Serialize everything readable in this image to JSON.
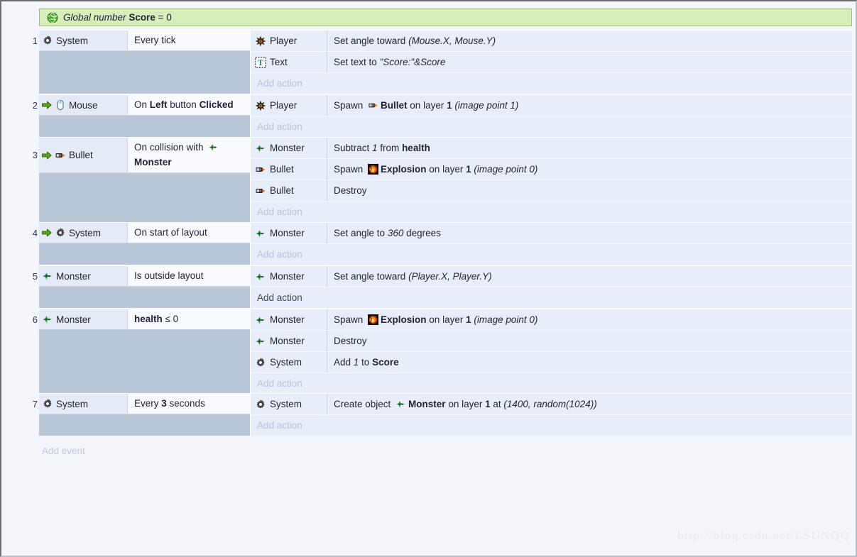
{
  "window": {
    "watermark": "http://blog.csdn.net/LSUNQQ"
  },
  "global_variable": {
    "icon": "globe-icon",
    "prefix": "Global number",
    "name": "Score",
    "equals": "=",
    "value": "0"
  },
  "add_event_label": "Add event",
  "add_action_label": "Add action",
  "events": [
    {
      "number": "1",
      "conditions": [
        {
          "arrow": false,
          "icon": "system-gear-icon",
          "object": "System",
          "text_parts": [
            {
              "t": "Every tick"
            }
          ]
        }
      ],
      "actions": [
        {
          "icon": "player-icon",
          "object": "Player",
          "text_parts": [
            {
              "t": "Set angle toward "
            },
            {
              "t": "(Mouse.X, Mouse.Y)",
              "style": "i"
            }
          ]
        },
        {
          "icon": "text-object-icon",
          "object": "Text",
          "text_parts": [
            {
              "t": "Set text to "
            },
            {
              "t": "\"Score:\"&Score",
              "style": "i"
            }
          ]
        }
      ],
      "add_action_hover": false
    },
    {
      "number": "2",
      "conditions": [
        {
          "arrow": true,
          "icon": "mouse-icon",
          "object": "Mouse",
          "text_parts": [
            {
              "t": "On "
            },
            {
              "t": "Left",
              "style": "b"
            },
            {
              "t": " button "
            },
            {
              "t": "Clicked",
              "style": "b"
            }
          ]
        }
      ],
      "actions": [
        {
          "icon": "player-icon",
          "object": "Player",
          "text_parts": [
            {
              "t": "Spawn "
            },
            {
              "inline_icon": "bullet-icon"
            },
            {
              "t": "Bullet",
              "style": "b"
            },
            {
              "t": " on layer "
            },
            {
              "t": "1",
              "style": "b"
            },
            {
              "t": " (image point 1)",
              "style": "i"
            }
          ]
        }
      ],
      "add_action_hover": false
    },
    {
      "number": "3",
      "conditions": [
        {
          "arrow": true,
          "icon": "bullet-icon",
          "object": "Bullet",
          "text_parts": [
            {
              "t": "On collision with "
            },
            {
              "inline_icon": "monster-icon"
            },
            {
              "t": "Monster",
              "style": "b",
              "newline": true
            }
          ]
        }
      ],
      "actions": [
        {
          "icon": "monster-icon",
          "object": "Monster",
          "text_parts": [
            {
              "t": "Subtract "
            },
            {
              "t": "1",
              "style": "i"
            },
            {
              "t": " from "
            },
            {
              "t": "health",
              "style": "b"
            }
          ]
        },
        {
          "icon": "bullet-icon",
          "object": "Bullet",
          "text_parts": [
            {
              "t": "Spawn "
            },
            {
              "inline_icon": "explosion-icon"
            },
            {
              "t": "Explosion",
              "style": "b"
            },
            {
              "t": " on layer "
            },
            {
              "t": "1",
              "style": "b"
            },
            {
              "t": " (image point 0)",
              "style": "i"
            }
          ]
        },
        {
          "icon": "bullet-icon",
          "object": "Bullet",
          "text_parts": [
            {
              "t": "Destroy"
            }
          ]
        }
      ],
      "add_action_hover": false
    },
    {
      "number": "4",
      "conditions": [
        {
          "arrow": true,
          "icon": "system-gear-icon",
          "object": "System",
          "text_parts": [
            {
              "t": "On start of layout"
            }
          ]
        }
      ],
      "actions": [
        {
          "icon": "monster-icon",
          "object": "Monster",
          "text_parts": [
            {
              "t": "Set angle to "
            },
            {
              "t": "360",
              "style": "i"
            },
            {
              "t": " degrees"
            }
          ]
        }
      ],
      "add_action_hover": false
    },
    {
      "number": "5",
      "conditions": [
        {
          "arrow": false,
          "icon": "monster-icon",
          "object": "Monster",
          "text_parts": [
            {
              "t": "Is outside layout"
            }
          ]
        }
      ],
      "actions": [
        {
          "icon": "monster-icon",
          "object": "Monster",
          "text_parts": [
            {
              "t": "Set angle toward "
            },
            {
              "t": "(Player.X, Player.Y)",
              "style": "i"
            }
          ]
        }
      ],
      "add_action_hover": true
    },
    {
      "number": "6",
      "conditions": [
        {
          "arrow": false,
          "icon": "monster-icon",
          "object": "Monster",
          "text_parts": [
            {
              "t": "health",
              "style": "b"
            },
            {
              "t": " ≤ 0"
            }
          ]
        }
      ],
      "actions": [
        {
          "icon": "monster-icon",
          "object": "Monster",
          "text_parts": [
            {
              "t": "Spawn "
            },
            {
              "inline_icon": "explosion-icon"
            },
            {
              "t": "Explosion",
              "style": "b"
            },
            {
              "t": " on layer "
            },
            {
              "t": "1",
              "style": "b"
            },
            {
              "t": " (image point 0)",
              "style": "i"
            }
          ]
        },
        {
          "icon": "monster-icon",
          "object": "Monster",
          "text_parts": [
            {
              "t": "Destroy"
            }
          ]
        },
        {
          "icon": "system-gear-icon",
          "object": "System",
          "text_parts": [
            {
              "t": "Add "
            },
            {
              "t": "1",
              "style": "i"
            },
            {
              "t": " to "
            },
            {
              "t": "Score",
              "style": "b"
            }
          ]
        }
      ],
      "add_action_hover": false
    },
    {
      "number": "7",
      "conditions": [
        {
          "arrow": false,
          "icon": "system-gear-icon",
          "object": "System",
          "text_parts": [
            {
              "t": "Every "
            },
            {
              "t": "3",
              "style": "b"
            },
            {
              "t": " seconds"
            }
          ]
        }
      ],
      "actions": [
        {
          "icon": "system-gear-icon",
          "object": "System",
          "text_parts": [
            {
              "t": "Create object "
            },
            {
              "inline_icon": "monster-icon"
            },
            {
              "t": "Monster",
              "style": "b"
            },
            {
              "t": " on layer "
            },
            {
              "t": "1",
              "style": "b"
            },
            {
              "t": " at "
            },
            {
              "t": "(1400, random(1024))",
              "style": "i"
            }
          ]
        }
      ],
      "add_action_hover": false
    }
  ],
  "colors": {
    "globalvar_bg": "#d7eebb",
    "globalvar_border": "#9dbb7d",
    "event_bg": "#e7edf9",
    "condition_bg": "#f8fafd",
    "filler_bg": "#b9c7d9",
    "page_bg": "#f4f6fb",
    "muted_text": "#b7c4d9"
  }
}
